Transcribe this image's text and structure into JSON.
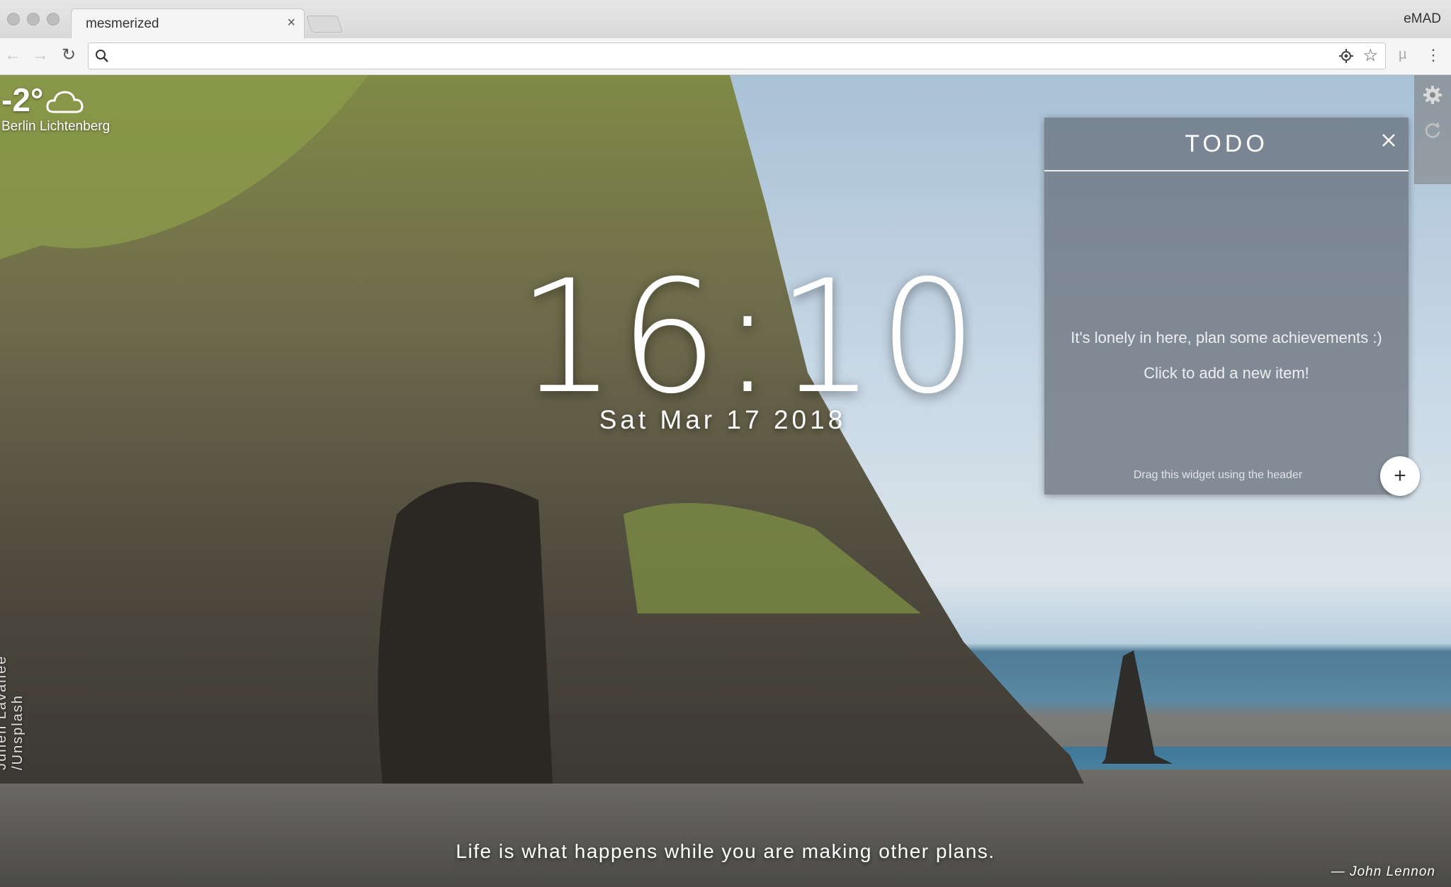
{
  "browser": {
    "tab_title": "mesmerized",
    "tab_close_icon": "×",
    "profile_name": "eMAD",
    "omnibox_value": "",
    "star_glyph": "☆",
    "extension_glyph": "µ",
    "menu_glyph": "⋮",
    "back_glyph": "←",
    "forward_glyph": "→",
    "reload_glyph": "↻"
  },
  "weather": {
    "temperature": "-2°",
    "location": "Berlin Lichtenberg",
    "icon": "cloud-icon"
  },
  "clock": {
    "time": "16:10",
    "date": "Sat Mar 17 2018"
  },
  "todo": {
    "title": "TODO",
    "empty_message": "It's lonely in here, plan some achievements :)",
    "add_prompt": "Click to add a new item!",
    "drag_hint": "Drag this widget using the header",
    "add_button": "+"
  },
  "quote": {
    "text": "Life is what happens while you are making other plans.",
    "author": "— John Lennon"
  },
  "photo_credit": "Julien Lavallée /Unsplash",
  "colors": {
    "todo_panel": "#646c76",
    "accent_white": "#ffffff"
  }
}
